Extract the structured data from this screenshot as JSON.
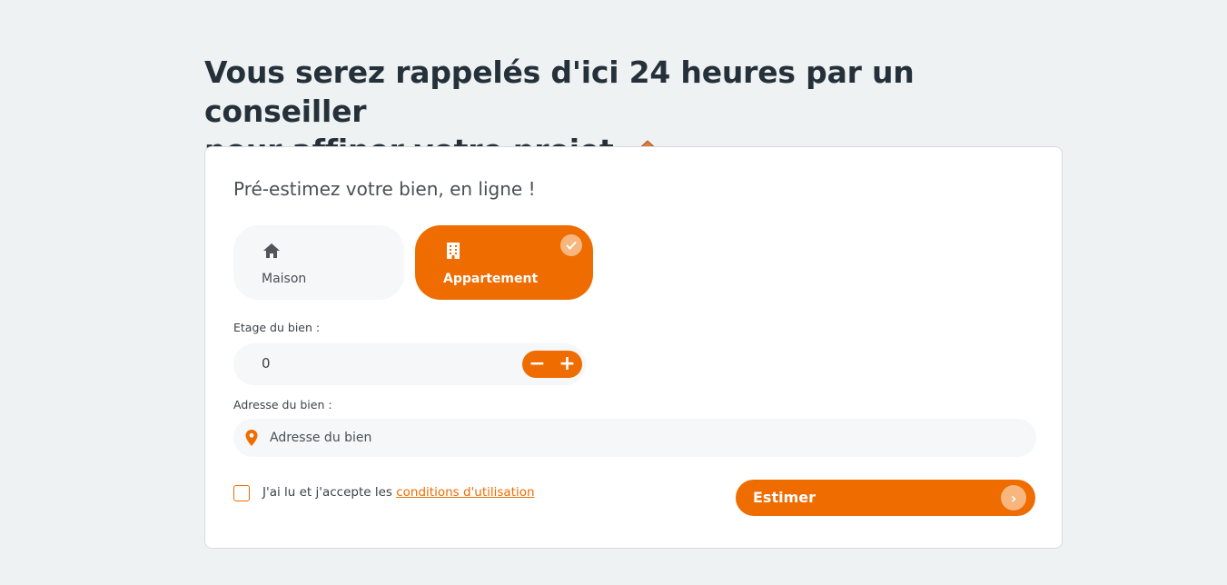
{
  "headline": {
    "line1": "Vous serez rappelés d'ici 24 heures par un conseiller",
    "line2": "pour affiner votre projet",
    "emoji_icon": "house-with-garden-icon"
  },
  "card": {
    "title": "Pré-estimez votre bien, en ligne !",
    "property_types": [
      {
        "label": "Maison",
        "icon": "house-icon",
        "selected": false
      },
      {
        "label": "Appartement",
        "icon": "building-icon",
        "selected": true
      }
    ],
    "floor": {
      "label": "Etage du bien :",
      "value": "0",
      "minus": "−",
      "plus": "+"
    },
    "address": {
      "label": "Adresse du bien :",
      "placeholder": "Adresse du bien",
      "icon": "map-pin-icon"
    },
    "terms": {
      "prefix": "J'ai lu et j'accepte les ",
      "link": "conditions d'utilisation",
      "checked": false
    },
    "submit": {
      "label": "Estimer",
      "arrow": "›"
    }
  },
  "colors": {
    "accent": "#ef6c00",
    "accent_light": "#f6b67e",
    "background": "#eff2f3",
    "field_bg": "#f5f7f8"
  }
}
